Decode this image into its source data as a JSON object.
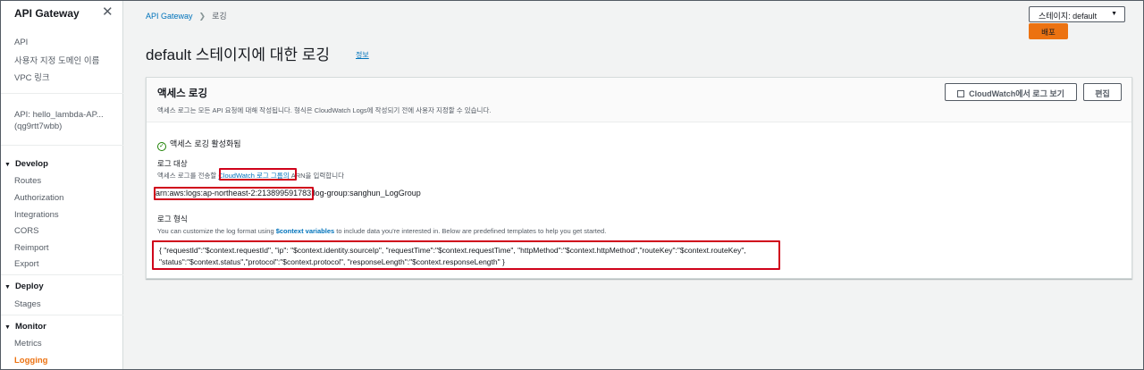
{
  "sidebar": {
    "title": "API Gateway",
    "close_icon": "close-icon",
    "top_links": [
      "API",
      "사용자 지정 도메인 이름",
      "VPC 링크"
    ],
    "api_line1": "API: hello_lambda-AP...",
    "api_line2": "(qg9rtt7wbb)",
    "sections": [
      {
        "label": "Develop",
        "items": [
          "Routes",
          "Authorization",
          "Integrations",
          "CORS",
          "Reimport",
          "Export"
        ]
      },
      {
        "label": "Deploy",
        "items": [
          "Stages"
        ]
      },
      {
        "label": "Monitor",
        "items": [
          "Metrics",
          "Logging"
        ]
      }
    ],
    "active_item": "Logging"
  },
  "header": {
    "breadcrumb_root": "API Gateway",
    "breadcrumb_current": "로깅",
    "stage_select": "스테이지: default",
    "deploy_label": "배포",
    "page_title": "default 스테이지에 대한 로깅",
    "info_link": "정보"
  },
  "panel": {
    "title": "액세스 로깅",
    "description": "액세스 로그는 모든 API 요청에 대해 작성됩니다. 형식은 CloudWatch Logs에 작성되기 전에 사용자 지정할 수 있습니다.",
    "cloudwatch_button": "CloudWatch에서 로그 보기",
    "edit_button": "편집",
    "status": "액세스 로깅 활성화됨",
    "destination_label": "로그 대상",
    "destination_desc_prefix": "액세스 로그를 전송할 ",
    "destination_desc_link": "CloudWatch 로그 그룹의",
    "destination_desc_suffix": " ARN을 입력합니다",
    "arn": "arn:aws:logs:ap-northeast-2:213899591783:log-group:sanghun_LogGroup",
    "format_label": "로그 형식",
    "format_desc_prefix": "You can customize the log format using ",
    "format_desc_link": "$context variables",
    "format_desc_suffix": " to include data you're interested in. Below are predefined templates to help you get started.",
    "format_line1": "{ \"requestId\":\"$context.requestId\", \"ip\": \"$context.identity.sourceIp\", \"requestTime\":\"$context.requestTime\", \"httpMethod\":\"$context.httpMethod\",\"routeKey\":\"$context.routeKey\",",
    "format_line2": "\"status\":\"$context.status\",\"protocol\":\"$context.protocol\", \"responseLength\":\"$context.responseLength\" }"
  },
  "colors": {
    "accent": "#ec7211",
    "link": "#0073bb",
    "highlight": "#d0021b",
    "success": "#1d8102"
  }
}
